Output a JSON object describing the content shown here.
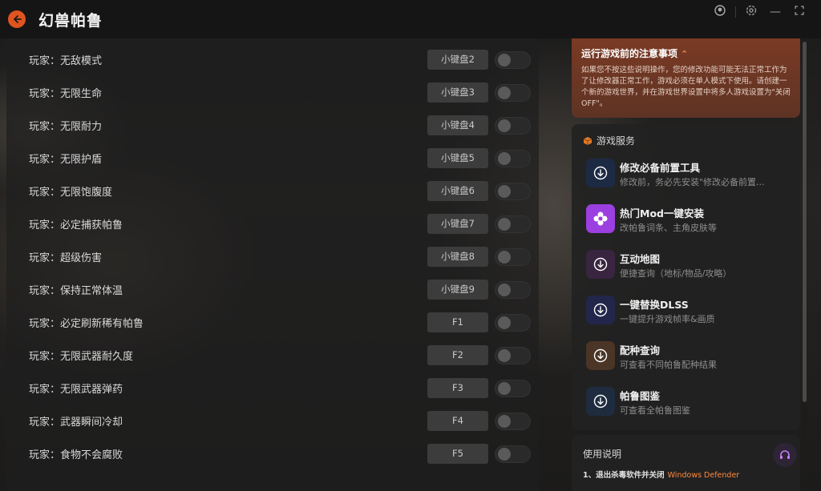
{
  "app": {
    "title": "幻兽帕鲁"
  },
  "cheats": [
    {
      "label": "玩家：无敌模式",
      "hotkey": "小键盘2"
    },
    {
      "label": "玩家：无限生命",
      "hotkey": "小键盘3"
    },
    {
      "label": "玩家：无限耐力",
      "hotkey": "小键盘4"
    },
    {
      "label": "玩家：无限护盾",
      "hotkey": "小键盘5"
    },
    {
      "label": "玩家：无限饱腹度",
      "hotkey": "小键盘6"
    },
    {
      "label": "玩家：必定捕获帕鲁",
      "hotkey": "小键盘7"
    },
    {
      "label": "玩家：超级伤害",
      "hotkey": "小键盘8"
    },
    {
      "label": "玩家：保持正常体温",
      "hotkey": "小键盘9"
    },
    {
      "label": "玩家：必定刷新稀有帕鲁",
      "hotkey": "F1"
    },
    {
      "label": "玩家：无限武器耐久度",
      "hotkey": "F2"
    },
    {
      "label": "玩家：无限武器弹药",
      "hotkey": "F3"
    },
    {
      "label": "玩家：武器瞬间冷却",
      "hotkey": "F4"
    },
    {
      "label": "玩家：食物不会腐败",
      "hotkey": "F5"
    }
  ],
  "notice": {
    "title": "运行游戏前的注意事项",
    "body": "如果您不按这些说明操作，您的修改功能可能无法正常工作为了让修改器正常工作，游戏必须在单人模式下使用。请创建一个新的游戏世界，并在游戏世界设置中将多人游戏设置为\"关闭OFF\"。"
  },
  "services": {
    "title": "游戏服务",
    "items": [
      {
        "name": "修改必备前置工具",
        "desc": "修改前，务必先安装\"修改必备前置...",
        "icon": "download-icon",
        "color": "#1d2a44"
      },
      {
        "name": "热门Mod一键安装",
        "desc": "改帕鲁词条、主角皮肤等",
        "icon": "mod-flower-icon",
        "color": "#9b3fe0"
      },
      {
        "name": "互动地图",
        "desc": "便捷查询（地标/物品/攻略）",
        "icon": "download-icon",
        "color": "#3a2540"
      },
      {
        "name": "一键替换DLSS",
        "desc": "一键提升游戏帧率&画质",
        "icon": "download-icon",
        "color": "#22264a"
      },
      {
        "name": "配种查询",
        "desc": "可查看不同帕鲁配种结果",
        "icon": "download-icon",
        "color": "#4a3526"
      },
      {
        "name": "帕鲁图鉴",
        "desc": "可查看全帕鲁图鉴",
        "icon": "download-icon",
        "color": "#1f2c40"
      }
    ]
  },
  "help": {
    "title": "使用说明",
    "step1": "1、退出杀毒软件并关闭",
    "step1_highlight": "Windows Defender"
  }
}
